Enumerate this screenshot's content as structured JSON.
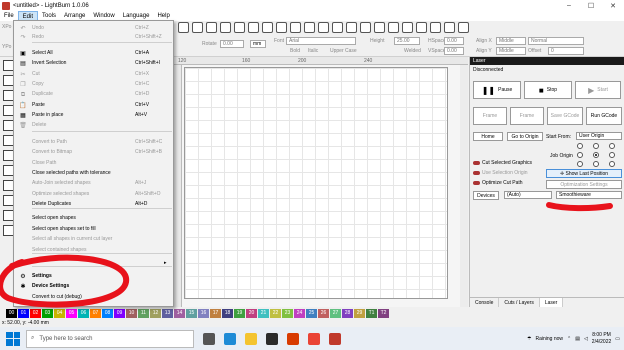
{
  "window": {
    "title": "<untitled> - LightBurn 1.0.06"
  },
  "menubar": [
    "File",
    "Edit",
    "Tools",
    "Arrange",
    "Window",
    "Language",
    "Help"
  ],
  "toolbar": {
    "rotate_label": "Rotate",
    "rotate_value": "0.00",
    "unit_button": "mm",
    "font_label": "Font",
    "font_value": "Arial",
    "height_label": "Height",
    "height_value": "25.00",
    "hspace_label": "HSpace",
    "hspace_value": "0.00",
    "vspace_label": "VSpace",
    "vspace_value": "0.00",
    "bold": "Bold",
    "italic": "Italic",
    "upper_case": "Upper Case",
    "welded": "Welded",
    "align_x_label": "Align X",
    "align_x_value": "Middle",
    "align_y_label": "Align Y",
    "align_y_value": "Middle",
    "normal_value": "Normal",
    "offset_label": "Offset",
    "offset_value": "0",
    "xpos_label": "XPo",
    "ypos_label": "YPo"
  },
  "edit_menu": {
    "items": [
      {
        "label": "Undo",
        "shortcut": "Ctrl+Z",
        "enabled": false,
        "icon": "undo-icon"
      },
      {
        "label": "Redo",
        "shortcut": "Ctrl+Shift+Z",
        "enabled": false,
        "icon": "redo-icon"
      },
      {
        "label": "Select All",
        "shortcut": "Ctrl+A",
        "enabled": true,
        "icon": "select-all-icon"
      },
      {
        "label": "Invert Selection",
        "shortcut": "Ctrl+Shift+I",
        "enabled": true,
        "icon": "invert-selection-icon"
      },
      {
        "label": "Cut",
        "shortcut": "Ctrl+X",
        "enabled": false,
        "icon": "cut-icon"
      },
      {
        "label": "Copy",
        "shortcut": "Ctrl+C",
        "enabled": false,
        "icon": "copy-icon"
      },
      {
        "label": "Duplicate",
        "shortcut": "Ctrl+D",
        "enabled": false,
        "icon": "duplicate-icon"
      },
      {
        "label": "Paste",
        "shortcut": "Ctrl+V",
        "enabled": true,
        "icon": "paste-icon"
      },
      {
        "label": "Paste in place",
        "shortcut": "Alt+V",
        "enabled": true,
        "icon": "paste-in-place-icon"
      },
      {
        "label": "Delete",
        "shortcut": "",
        "enabled": false,
        "icon": "delete-icon"
      },
      {
        "label": "Convert to Path",
        "shortcut": "Ctrl+Shift+C",
        "enabled": false,
        "icon": ""
      },
      {
        "label": "Convert to Bitmap",
        "shortcut": "Ctrl+Shift+B",
        "enabled": false,
        "icon": ""
      },
      {
        "label": "Close Path",
        "shortcut": "",
        "enabled": false,
        "icon": ""
      },
      {
        "label": "Close selected paths with tolerance",
        "shortcut": "",
        "enabled": true,
        "icon": ""
      },
      {
        "label": "Auto-Join selected shapes",
        "shortcut": "Alt+J",
        "enabled": false,
        "icon": ""
      },
      {
        "label": "Optimize selected shapes",
        "shortcut": "Alt+Shift+O",
        "enabled": false,
        "icon": ""
      },
      {
        "label": "Delete Duplicates",
        "shortcut": "Alt+D",
        "enabled": true,
        "icon": ""
      },
      {
        "label": "Select open shapes",
        "shortcut": "",
        "enabled": true,
        "icon": ""
      },
      {
        "label": "Select open shapes set to fill",
        "shortcut": "",
        "enabled": true,
        "icon": ""
      },
      {
        "label": "Select all shapes in current cut layer",
        "shortcut": "",
        "enabled": false,
        "icon": ""
      },
      {
        "label": "Select contained shapes",
        "shortcut": "",
        "enabled": false,
        "icon": ""
      },
      {
        "label": "",
        "shortcut": "",
        "enabled": true,
        "icon": "",
        "submenu": true
      },
      {
        "label": "Settings",
        "shortcut": "",
        "enabled": true,
        "icon": "settings-gear-icon"
      },
      {
        "label": "Device Settings",
        "shortcut": "",
        "enabled": true,
        "icon": "device-settings-icon"
      },
      {
        "label": "Convert to cut (debug)",
        "shortcut": "",
        "enabled": true,
        "icon": ""
      }
    ],
    "partial_hidden_label": "Debug D..."
  },
  "rulers": {
    "top": [
      "120",
      "160",
      "200",
      "240",
      "280",
      "320",
      "360",
      "400"
    ],
    "left": [
      "400",
      "440",
      "480",
      "120",
      "160",
      "200"
    ]
  },
  "laser_panel": {
    "header": "Laser",
    "status": "Disconnected",
    "pause": "Pause",
    "stop": "Stop",
    "start": "Start",
    "frame1": "Frame",
    "frame2": "Frame",
    "save_gcode": "Save GCode",
    "run_gcode": "Run GCode",
    "home": "Home",
    "go_to_origin": "Go to Origin",
    "start_from_label": "Start From:",
    "start_from_value": "User Origin",
    "job_origin_label": "Job Origin",
    "cut_selected": "Cut Selected Graphics",
    "use_selection_origin": "Use Selection Origin",
    "show_last_position": "Show Last Position",
    "optimize_cut_path": "Optimize Cut Path",
    "optimization_settings": "Optimization Settings",
    "devices_button": "Devices",
    "port_value": "(Auto)",
    "device_value": "Smoothieware",
    "tabs": [
      "Console",
      "Cuts / Layers",
      "Laser"
    ]
  },
  "palette": {
    "swatches": [
      "00",
      "01",
      "02",
      "03",
      "04",
      "05",
      "06",
      "07",
      "08",
      "09",
      "10",
      "11",
      "12",
      "13",
      "14",
      "15",
      "16",
      "17",
      "18",
      "19",
      "20",
      "21",
      "22",
      "23",
      "24",
      "25",
      "26",
      "27",
      "28",
      "29",
      "T1",
      "T2"
    ],
    "colors": [
      "#000000",
      "#0000ff",
      "#ff0000",
      "#00a000",
      "#c8b400",
      "#ff00ff",
      "#00b4b4",
      "#ff8000",
      "#0080ff",
      "#8000ff",
      "#a06060",
      "#60a060",
      "#a0a060",
      "#6060a0",
      "#a060a0",
      "#60a0a0",
      "#8080c0",
      "#c08040",
      "#404080",
      "#40a040",
      "#c04080",
      "#40c0c0",
      "#c0c040",
      "#80c040",
      "#c040c0",
      "#4080c0",
      "#c06060",
      "#60c080",
      "#8040c0",
      "#c0a040",
      "#408040",
      "#804080"
    ]
  },
  "statusbar": {
    "coords": "x: 52.00, y: -4.00 mm"
  },
  "taskbar": {
    "search_placeholder": "Type here to search",
    "weather": "Raining now",
    "time": "8:00 PM",
    "date": "2/4/2022"
  },
  "accent": "#e8121b"
}
